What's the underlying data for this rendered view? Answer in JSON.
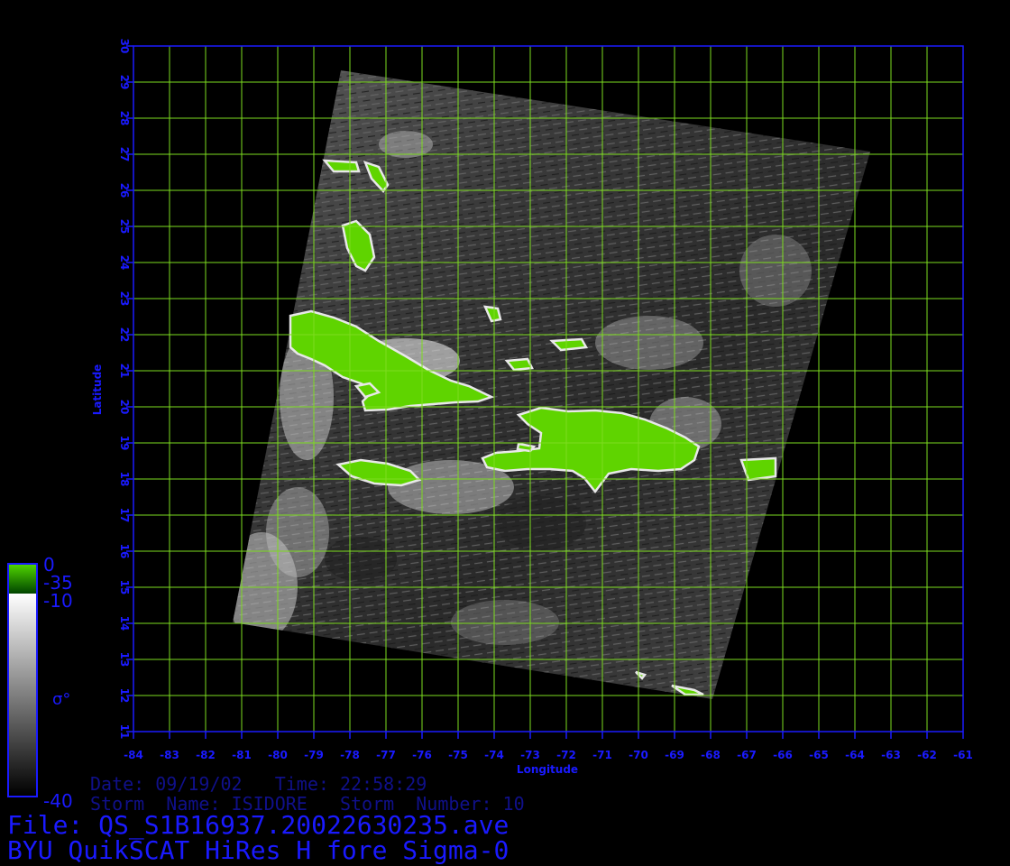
{
  "map": {
    "x_axis": {
      "label": "Longitude",
      "ticks": [
        "-84",
        "-83",
        "-82",
        "-81",
        "-80",
        "-79",
        "-78",
        "-77",
        "-76",
        "-75",
        "-74",
        "-73",
        "-72",
        "-71",
        "-70",
        "-69",
        "-68",
        "-67",
        "-66",
        "-65",
        "-64",
        "-63",
        "-62",
        "-61"
      ]
    },
    "y_axis": {
      "label": "Latitude",
      "ticks": [
        "11",
        "12",
        "13",
        "14",
        "15",
        "16",
        "17",
        "18",
        "19",
        "20",
        "21",
        "22",
        "23",
        "24",
        "25",
        "26",
        "27",
        "28",
        "29",
        "30"
      ]
    },
    "grid": true,
    "colors": {
      "grid": "#7ddc1f",
      "axis": "#1a1aff",
      "land": "#5fd400",
      "background": "#000000"
    }
  },
  "colorbar": {
    "land_top": "0",
    "land_bottom": "-35",
    "max": "-10",
    "min": "-40",
    "symbol": "σ°"
  },
  "info": {
    "date_line": "Date: 09/19/02   Time: 22:58:29",
    "storm_line": "Storm  Name: ISIDORE   Storm  Number: 10",
    "file_line": "File: QS_S1B16937.20022630235.ave",
    "title_line": "BYU QuikSCAT HiRes H fore Sigma-0"
  }
}
